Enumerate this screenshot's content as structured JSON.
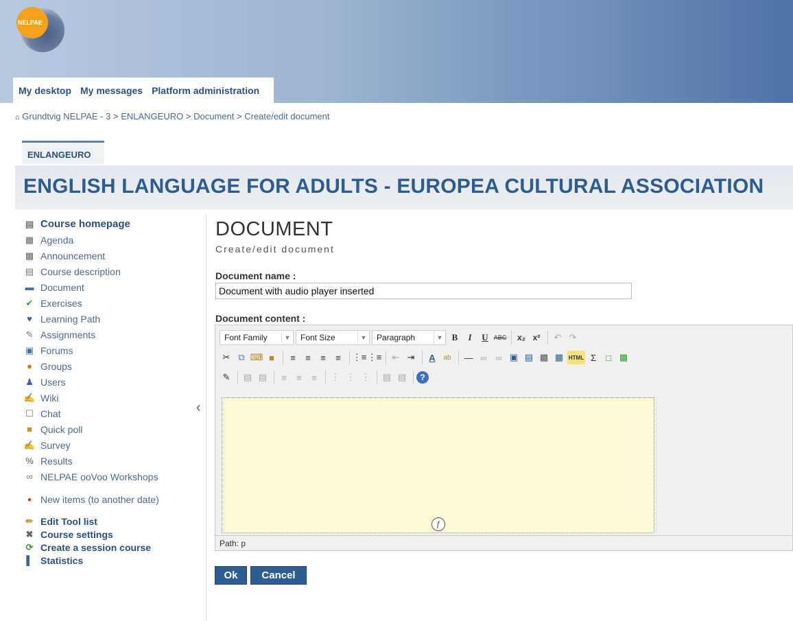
{
  "logo": {
    "text": "NELPAE"
  },
  "tabs": [
    {
      "label": "My desktop"
    },
    {
      "label": "My messages"
    },
    {
      "label": "Platform administration"
    }
  ],
  "breadcrumb": {
    "home_icon": "home-icon",
    "items": [
      "Grundtvig NELPAE - 3",
      "ENLANGEURO",
      "Document",
      "Create/edit document"
    ],
    "separator": ">"
  },
  "course": {
    "code": "ENLANGEURO",
    "title": "ENGLISH LANGUAGE FOR ADULTS - EUROPEA CULTURAL ASSOCIATION"
  },
  "sidebar": {
    "items": [
      {
        "label": "Course homepage",
        "icon": "course-homepage-icon"
      },
      {
        "label": "Agenda",
        "icon": "calendar-icon"
      },
      {
        "label": "Announcement",
        "icon": "announcement-icon"
      },
      {
        "label": "Course description",
        "icon": "description-icon"
      },
      {
        "label": "Document",
        "icon": "folder-icon"
      },
      {
        "label": "Exercises",
        "icon": "checkmark-icon"
      },
      {
        "label": "Learning Path",
        "icon": "learning-path-icon"
      },
      {
        "label": "Assignments",
        "icon": "assignment-icon"
      },
      {
        "label": "Forums",
        "icon": "forum-icon"
      },
      {
        "label": "Groups",
        "icon": "groups-icon"
      },
      {
        "label": "Users",
        "icon": "user-icon"
      },
      {
        "label": "Wiki",
        "icon": "wiki-icon"
      },
      {
        "label": "Chat",
        "icon": "chat-icon"
      },
      {
        "label": "Quick poll",
        "icon": "poll-icon"
      },
      {
        "label": "Survey",
        "icon": "survey-icon"
      },
      {
        "label": "Results",
        "icon": "percent-icon"
      },
      {
        "label": "NELPAE ooVoo Workshops",
        "icon": "link-icon"
      }
    ],
    "new_items": {
      "label": "New items (to another date)",
      "icon": "red-dot-icon"
    },
    "admin_items": [
      {
        "label": "Edit Tool list",
        "icon": "pencil-icon"
      },
      {
        "label": "Course settings",
        "icon": "tools-icon"
      },
      {
        "label": "Create a session course",
        "icon": "session-icon"
      },
      {
        "label": "Statistics",
        "icon": "bar-chart-icon"
      }
    ]
  },
  "page": {
    "title": "DOCUMENT",
    "subtitle": "Create/edit document"
  },
  "form": {
    "name_label": "Document name :",
    "name_value": "Document with audio player inserted",
    "content_label": "Document content :",
    "toolbar": {
      "font_family": "Font Family",
      "font_size": "Font Size",
      "format": "Paragraph"
    },
    "path_label": "Path: p",
    "ok_label": "Ok",
    "cancel_label": "Cancel"
  },
  "colors": {
    "accent": "#2b4f7e",
    "button": "#2f5d92",
    "editor_bg": "#fffbd4",
    "logo": "#f6a11d"
  }
}
